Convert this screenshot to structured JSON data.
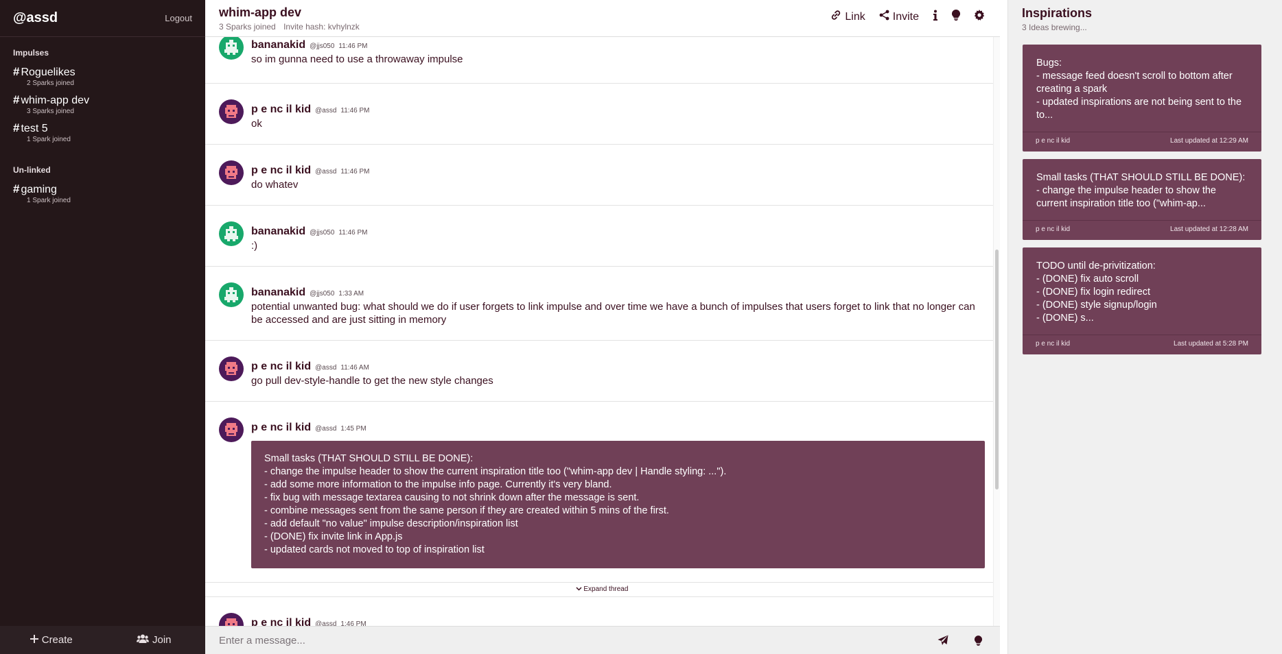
{
  "sidebar": {
    "username": "@assd",
    "logout": "Logout",
    "impulses_heading": "Impulses",
    "impulses": [
      {
        "hash": "#",
        "name": "Roguelikes",
        "sparks": "2 Sparks joined"
      },
      {
        "hash": "#",
        "name": "whim-app dev",
        "sparks": "3 Sparks joined"
      },
      {
        "hash": "#",
        "name": "test 5",
        "sparks": "1 Spark joined"
      }
    ],
    "unlinked_heading": "Un-linked",
    "unlinked": [
      {
        "hash": "#",
        "name": "gaming",
        "sparks": "1 Spark joined"
      }
    ],
    "create_label": "Create",
    "join_label": "Join"
  },
  "header": {
    "title": "whim-app dev",
    "sparks": "3 Sparks joined",
    "invite_hash": "Invite hash: kvhylnzk",
    "link_label": "Link",
    "invite_label": "Invite"
  },
  "messages": [
    {
      "name": "bananakid",
      "handle": "@jjs050",
      "time": "11:46 PM",
      "text": "so im gunna need to use a throwaway impulse"
    },
    {
      "name": "p e nc il kid",
      "handle": "@assd",
      "time": "11:46 PM",
      "text": "ok"
    },
    {
      "name": "p e nc il kid",
      "handle": "@assd",
      "time": "11:46 PM",
      "text": "do whatev"
    },
    {
      "name": "bananakid",
      "handle": "@jjs050",
      "time": "11:46 PM",
      "text": ":)"
    },
    {
      "name": "bananakid",
      "handle": "@jjs050",
      "time": "1:33 AM",
      "text": "potential unwanted bug: what should we do if user forgets to link impulse and over time we have a bunch of impulses that users forget to link that no longer can be accessed and are just sitting in memory"
    },
    {
      "name": "p e nc il kid",
      "handle": "@assd",
      "time": "11:46 AM",
      "text": "go pull dev-style-handle to get the new style changes"
    },
    {
      "name": "p e nc il kid",
      "handle": "@assd",
      "time": "1:45 PM",
      "card": [
        "Small tasks (THAT SHOULD STILL BE DONE):",
        "- change the impulse header to show the current inspiration title too (\"whim-app dev | Handle styling: ...\").",
        "- add some more information to the impulse info page. Currently it's very bland.",
        "- fix bug with message textarea causing to not shrink down after the message is sent.",
        "- combine messages sent from the same person if they are created within 5 mins of the first.",
        "- add default \"no value\" impulse description/inspiration list",
        "- (DONE) fix invite link in App.js",
        "- updated cards not moved to top of inspiration list"
      ]
    },
    {
      "name": "p e nc il kid",
      "handle": "@assd",
      "time": "1:46 PM",
      "text": ""
    }
  ],
  "expand_thread": "Expand thread",
  "composer": {
    "placeholder": "Enter a message..."
  },
  "inspirations": {
    "title": "Inspirations",
    "subtitle": "3 Ideas brewing...",
    "cards": [
      {
        "lines": [
          "Bugs:",
          "- message feed doesn't scroll to bottom after creating a spark",
          "- updated inspirations are not being sent to the to..."
        ],
        "author": "p e nc il kid",
        "updated": "Last updated at 12:29 AM"
      },
      {
        "lines": [
          "Small tasks (THAT SHOULD STILL BE DONE):",
          "- change the impulse header to show the current inspiration title too (\"whim-ap..."
        ],
        "author": "p e nc il kid",
        "updated": "Last updated at 12:28 AM"
      },
      {
        "lines": [
          "TODO until de-privitization:",
          "- (DONE) fix auto scroll",
          "- (DONE) fix login redirect",
          "- (DONE) style signup/login",
          "- (DONE) s..."
        ],
        "author": "p e nc il kid",
        "updated": "Last updated at 5:28 PM"
      }
    ]
  },
  "colors": {
    "sidebar_bg": "#241719",
    "card_bg": "#704057",
    "text_primary": "#3a0f1f",
    "avatar_green": "#18a86b",
    "avatar_purple": "#4d1a5a"
  },
  "icons": {
    "link": "link-icon",
    "invite": "share-icon",
    "info": "info-icon",
    "idea": "lightbulb-icon",
    "settings": "gear-icon",
    "send": "send-icon",
    "create": "plus-icon",
    "join": "users-icon",
    "expand": "chevron-down-icon"
  }
}
